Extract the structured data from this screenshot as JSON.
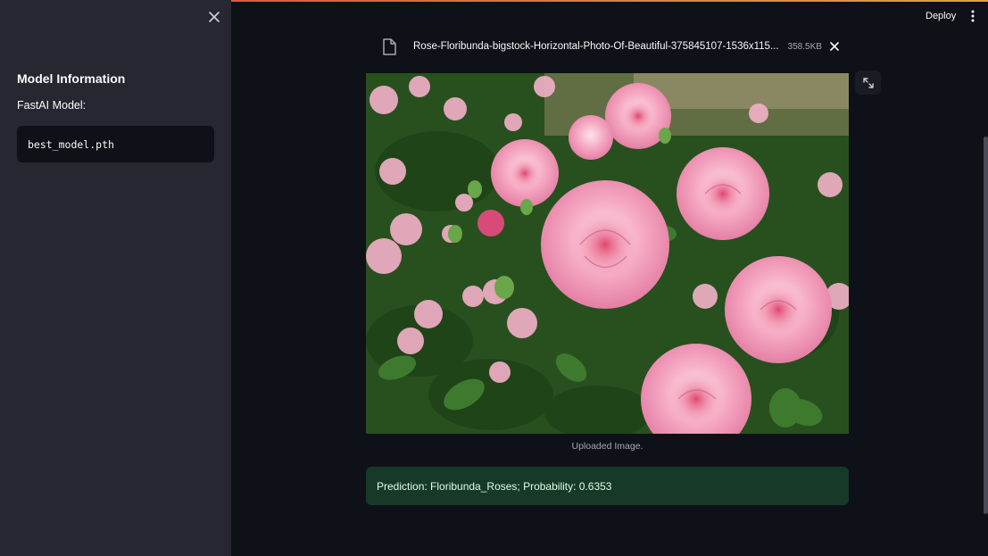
{
  "sidebar": {
    "close_icon": "close-icon",
    "title": "Model Information",
    "model_label": "FastAI Model:",
    "model_file": "best_model.pth"
  },
  "header": {
    "deploy_label": "Deploy",
    "menu_icon": "more-vertical-icon"
  },
  "uploader": {
    "file_icon": "file-icon",
    "file_name": "Rose-Floribunda-bigstock-Horizontal-Photo-Of-Beautiful-375845107-1536x115...",
    "file_size": "358.5KB",
    "remove_icon": "close-icon"
  },
  "image": {
    "caption": "Uploaded Image.",
    "fullscreen_icon": "fullscreen-icon"
  },
  "result": {
    "text": "Prediction: Floribunda_Roses; Probability: 0.6353"
  },
  "colors": {
    "app_bg": "#0e1117",
    "sidebar_bg": "#262730",
    "success_bg": "#173928",
    "success_text": "#dffde9"
  }
}
